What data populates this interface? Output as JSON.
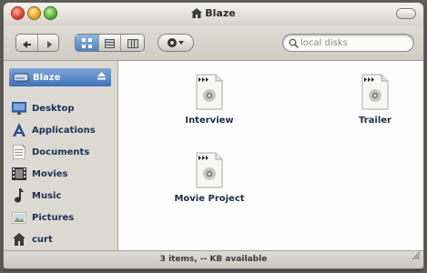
{
  "window": {
    "title": "Blaze"
  },
  "toolbar": {
    "search_placeholder": "local disks",
    "back_icon": "back-arrow-icon",
    "forward_icon": "forward-arrow-icon",
    "view_modes": [
      "icon-view",
      "list-view",
      "column-view"
    ],
    "selected_view": "icon-view",
    "action_icon": "gear-icon"
  },
  "sidebar": {
    "volume": {
      "label": "Blaze",
      "icon": "disk-icon"
    },
    "items": [
      {
        "label": "Desktop",
        "icon": "desktop-icon"
      },
      {
        "label": "Applications",
        "icon": "applications-icon"
      },
      {
        "label": "Documents",
        "icon": "documents-icon"
      },
      {
        "label": "Movies",
        "icon": "movies-icon"
      },
      {
        "label": "Music",
        "icon": "music-icon"
      },
      {
        "label": "Pictures",
        "icon": "pictures-icon"
      },
      {
        "label": "curt",
        "icon": "home-icon"
      }
    ]
  },
  "files": [
    {
      "name": "Interview",
      "icon": "media-document-icon"
    },
    {
      "name": "Trailer",
      "icon": "media-document-icon"
    },
    {
      "name": "Movie Project",
      "icon": "media-document-icon"
    }
  ],
  "status": {
    "text": "3 items, -- KB available"
  },
  "colors": {
    "selection": "#4f82c7",
    "sidebar_text": "#1c2f55"
  }
}
